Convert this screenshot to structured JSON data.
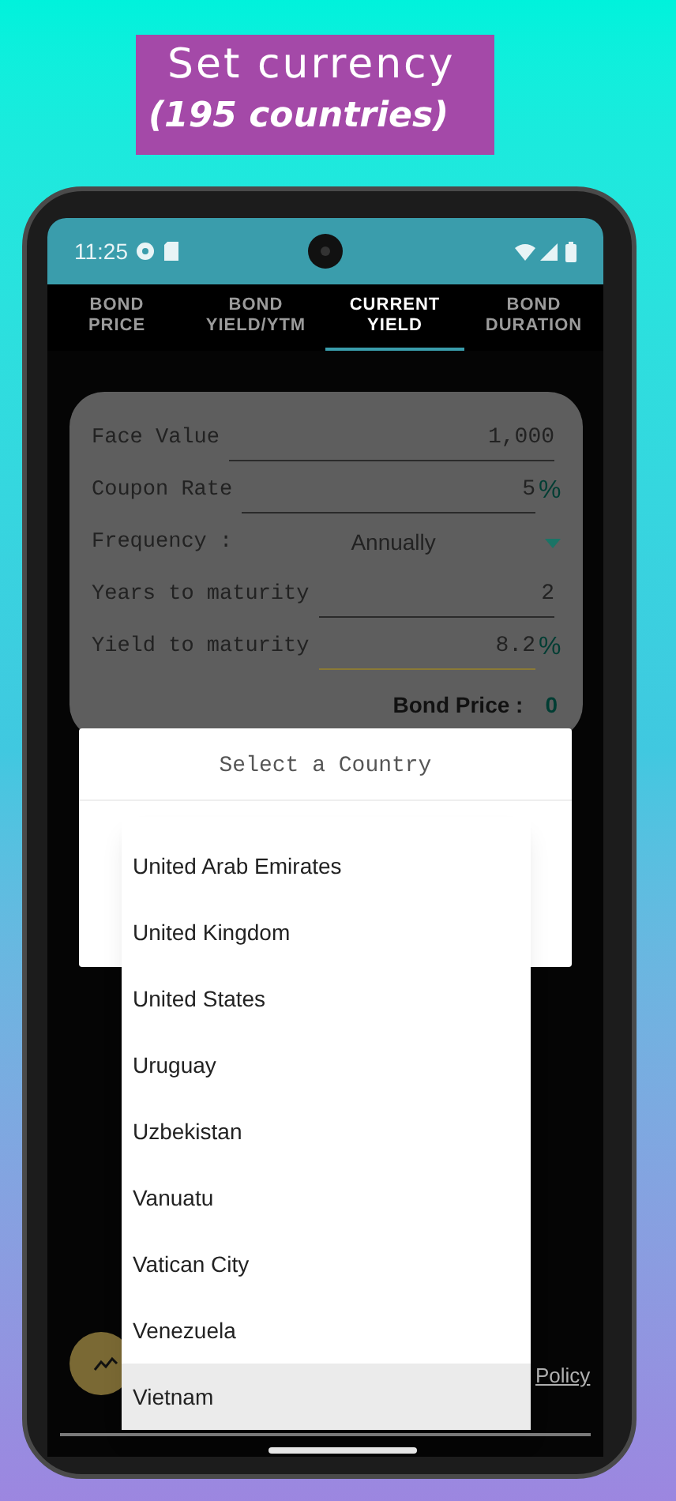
{
  "banner": {
    "title": "Set currency",
    "subtitle": "(195 countries)"
  },
  "status_bar": {
    "time": "11:25"
  },
  "tabs": [
    {
      "lines": [
        "BOND",
        "PRICE"
      ],
      "selected": false
    },
    {
      "lines": [
        "BOND",
        "YIELD/YTM"
      ],
      "selected": false
    },
    {
      "lines": [
        "CURRENT",
        "YIELD"
      ],
      "selected": true
    },
    {
      "lines": [
        "BOND",
        "DURATION"
      ],
      "selected": false
    }
  ],
  "form": {
    "fields": [
      {
        "kind": "input",
        "label": "Face Value",
        "value": "1,000",
        "focused": false
      },
      {
        "kind": "input",
        "label": "Coupon Rate",
        "value": "5",
        "unit": "%",
        "focused": false
      },
      {
        "kind": "select",
        "label": "Frequency :",
        "value": "Annually"
      },
      {
        "kind": "input",
        "label": "Years to maturity",
        "value": "2",
        "focused": false
      },
      {
        "kind": "input",
        "label": "Yield to maturity",
        "value": "8.2",
        "unit": "%",
        "focused": true
      }
    ],
    "result": {
      "label": "Bond Price :",
      "value": "0"
    }
  },
  "dialog": {
    "title": "Select a Country"
  },
  "country_list": [
    {
      "name": "United Arab Emirates",
      "selected": false
    },
    {
      "name": "United Kingdom",
      "selected": false
    },
    {
      "name": "United States",
      "selected": false
    },
    {
      "name": "Uruguay",
      "selected": false
    },
    {
      "name": "Uzbekistan",
      "selected": false
    },
    {
      "name": "Vanuatu",
      "selected": false
    },
    {
      "name": "Vatican City",
      "selected": false
    },
    {
      "name": "Venezuela",
      "selected": false
    },
    {
      "name": "Vietnam",
      "selected": true
    }
  ],
  "footer": {
    "link": "Policy"
  }
}
